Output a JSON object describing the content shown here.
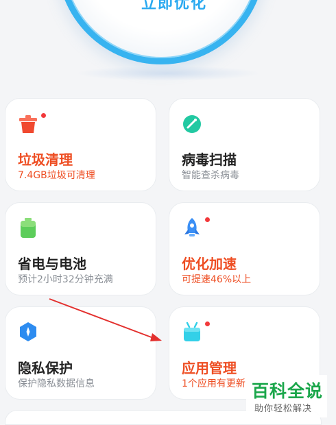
{
  "hero": {
    "button_label": "立即优化"
  },
  "cards": [
    {
      "title": "垃圾清理",
      "subtitle": "7.4GB垃圾可清理",
      "icon": "trash-icon",
      "alert": true,
      "badge": true
    },
    {
      "title": "病毒扫描",
      "subtitle": "智能查杀病毒",
      "icon": "virus-scan-icon",
      "alert": false,
      "badge": false
    },
    {
      "title": "省电与电池",
      "subtitle": "预计2小时32分钟充满",
      "icon": "battery-icon",
      "alert": false,
      "badge": false
    },
    {
      "title": "优化加速",
      "subtitle": "可提速46%以上",
      "icon": "rocket-icon",
      "alert": true,
      "badge": true
    },
    {
      "title": "隐私保护",
      "subtitle": "保护隐私数据信息",
      "icon": "privacy-shield-icon",
      "alert": false,
      "badge": false
    },
    {
      "title": "应用管理",
      "subtitle": "1个应用有更新",
      "icon": "app-manager-icon",
      "alert": true,
      "badge": true
    }
  ],
  "watermark": {
    "main": "百科全说",
    "sub": "助你轻松解决"
  },
  "colors": {
    "accent_blue": "#37b3f0",
    "alert_red": "#ee4e23",
    "badge_red": "#f2393b",
    "watermark_green": "#1aa64a"
  }
}
